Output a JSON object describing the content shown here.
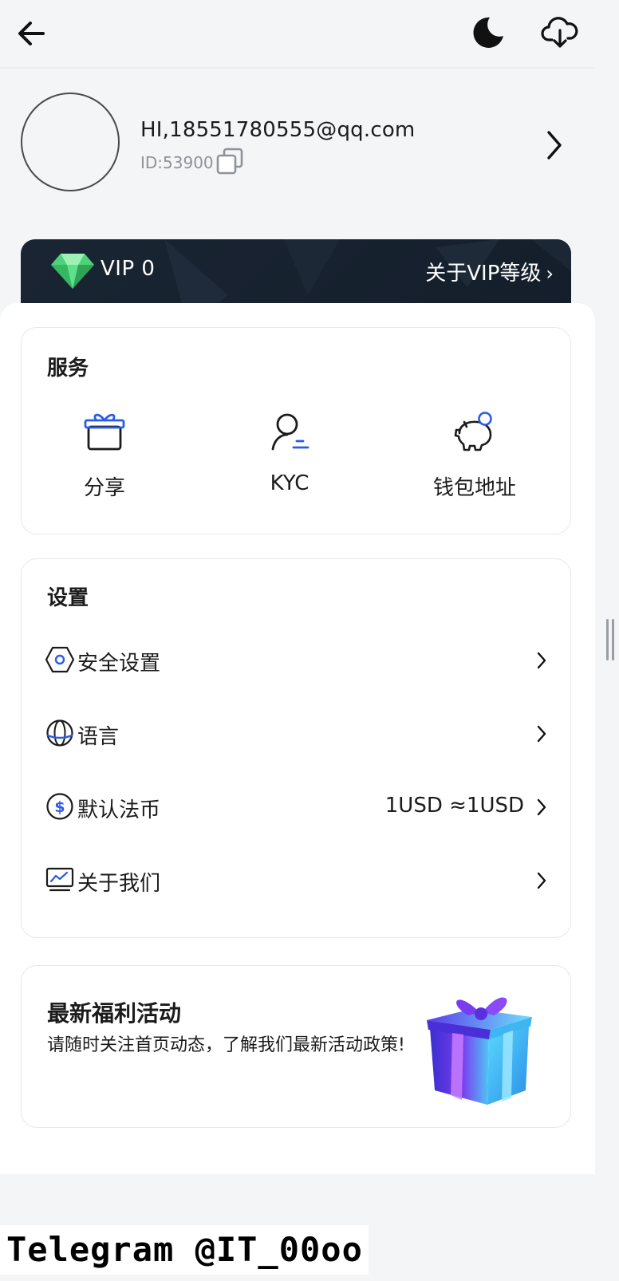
{
  "header": {
    "back_icon": "arrow-left-icon",
    "theme_icon": "moon-icon",
    "download_icon": "cloud-download-icon"
  },
  "profile": {
    "greeting": "HI,18551780555@qq.com",
    "id_text": "ID:53900",
    "copy_icon": "copy-icon",
    "arrow_icon": "chevron-right-icon"
  },
  "vip": {
    "level": "VIP 0",
    "about_label": "关于VIP等级",
    "gem_icon": "diamond-icon"
  },
  "services": {
    "title": "服务",
    "items": [
      {
        "label": "分享",
        "icon": "gift-icon"
      },
      {
        "label": "KYC",
        "icon": "user-verify-icon"
      },
      {
        "label": "钱包地址",
        "icon": "piggy-bank-icon"
      }
    ]
  },
  "settings": {
    "title": "设置",
    "items": [
      {
        "label": "安全设置",
        "icon": "shield-hexagon-icon",
        "value": ""
      },
      {
        "label": "语言",
        "icon": "globe-icon",
        "value": ""
      },
      {
        "label": "默认法币",
        "icon": "dollar-icon",
        "value": "1USD ≈1USD"
      },
      {
        "label": "关于我们",
        "icon": "monitor-chart-icon",
        "value": ""
      }
    ]
  },
  "promo": {
    "title": "最新福利活动",
    "description": "请随时关注首页动态，了解我们最新活动政策!",
    "image_icon": "gift-box-icon"
  },
  "watermark": {
    "text": "Telegram @IT_00oo"
  },
  "colors": {
    "accent": "#2b5ce6",
    "vip_banner": "#17212e",
    "background": "#f3f5f7"
  }
}
